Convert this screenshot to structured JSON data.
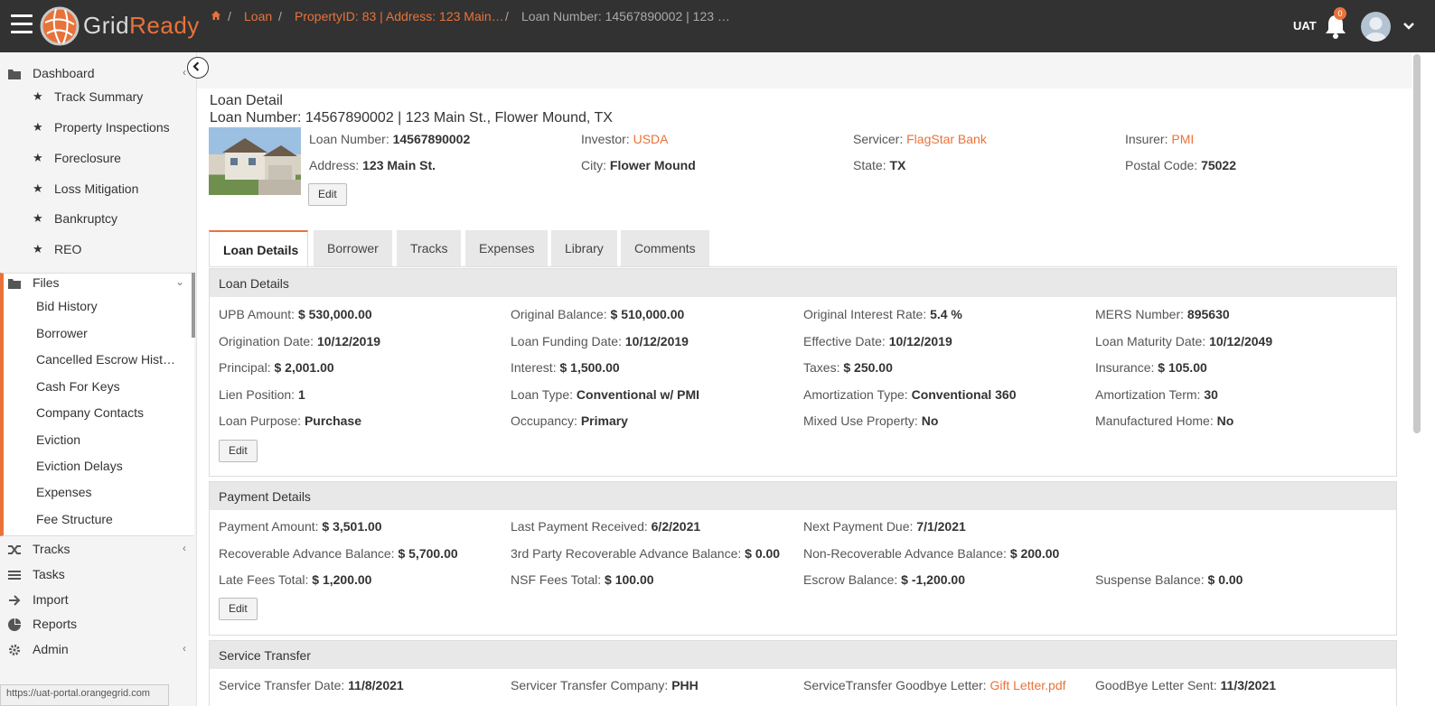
{
  "header": {
    "logo_grid": "Grid",
    "logo_ready": "Ready",
    "env": "UAT",
    "notif_count": "0",
    "accent": "#e8733a",
    "bar_color": "#323232"
  },
  "sidebar": {
    "dashboard": "Dashboard",
    "dashboard_items": [
      "Track Summary",
      "Property Inspections",
      "Foreclosure",
      "Loss Mitigation",
      "Bankruptcy",
      "REO"
    ],
    "files": "Files",
    "files_items": [
      "Bid History",
      "Borrower",
      "Cancelled Escrow Hist…",
      "Cash For Keys",
      "Company Contacts",
      "Eviction",
      "Eviction Delays",
      "Expenses",
      "Fee Structure"
    ],
    "tracks": "Tracks",
    "tasks": "Tasks",
    "import": "Import",
    "reports": "Reports",
    "admin": "Admin"
  },
  "status_url": "https://uat-portal.orangegrid.com",
  "breadcrumb": {
    "loan": "Loan",
    "property": "PropertyID: 83 | Address: 123 Main…",
    "current": "Loan Number: 14567890002 | 123 …"
  },
  "page": {
    "title": "Loan Detail",
    "subtitle": "Loan Number: 14567890002 | 123 Main St., Flower Mound, TX"
  },
  "summary": {
    "loan_number_label": "Loan Number:",
    "loan_number": "14567890002",
    "investor_label": "Investor:",
    "investor": "USDA",
    "servicer_label": "Servicer:",
    "servicer": "FlagStar Bank",
    "insurer_label": "Insurer:",
    "insurer": "PMI",
    "address_label": "Address:",
    "address": "123 Main St.",
    "city_label": "City:",
    "city": "Flower Mound",
    "state_label": "State:",
    "state": "TX",
    "postal_label": "Postal Code:",
    "postal": "75022",
    "edit": "Edit"
  },
  "tabs": [
    "Loan Details",
    "Borrower",
    "Tracks",
    "Expenses",
    "Library",
    "Comments"
  ],
  "loan_details": {
    "title": "Loan Details",
    "edit": "Edit",
    "rows": [
      [
        [
          "UPB Amount:",
          "$ 530,000.00"
        ],
        [
          "Original Balance:",
          "$ 510,000.00"
        ],
        [
          "Original Interest Rate:",
          "5.4 %"
        ],
        [
          "MERS Number:",
          "895630"
        ]
      ],
      [
        [
          "Origination Date:",
          "10/12/2019"
        ],
        [
          "Loan Funding Date:",
          "10/12/2019"
        ],
        [
          "Effective Date:",
          "10/12/2019"
        ],
        [
          "Loan Maturity Date:",
          "10/12/2049"
        ]
      ],
      [
        [
          "Principal:",
          "$ 2,001.00"
        ],
        [
          "Interest:",
          "$ 1,500.00"
        ],
        [
          "Taxes:",
          "$ 250.00"
        ],
        [
          "Insurance:",
          "$ 105.00"
        ]
      ],
      [
        [
          "Lien Position:",
          "1"
        ],
        [
          "Loan Type:",
          "Conventional w/ PMI"
        ],
        [
          "Amortization Type:",
          "Conventional 360"
        ],
        [
          "Amortization Term:",
          "30"
        ]
      ],
      [
        [
          "Loan Purpose:",
          "Purchase"
        ],
        [
          "Occupancy:",
          "Primary"
        ],
        [
          "Mixed Use Property:",
          "No"
        ],
        [
          "Manufactured Home:",
          "No"
        ]
      ]
    ]
  },
  "payment_details": {
    "title": "Payment Details",
    "edit": "Edit",
    "rows": [
      [
        [
          "Payment Amount:",
          "$ 3,501.00"
        ],
        [
          "Last Payment Received:",
          "6/2/2021"
        ],
        [
          "Next Payment Due:",
          "7/1/2021"
        ]
      ],
      [
        [
          "Recoverable Advance Balance:",
          "$ 5,700.00"
        ],
        [
          "3rd Party Recoverable Advance Balance:",
          "$ 0.00"
        ],
        [
          "Non-Recoverable Advance Balance:",
          "$ 200.00"
        ]
      ],
      [
        [
          "Late Fees Total:",
          "$ 1,200.00"
        ],
        [
          "NSF Fees Total:",
          "$ 100.00"
        ],
        [
          "Escrow Balance:",
          "$ -1,200.00"
        ],
        [
          "Suspense Balance:",
          "$ 0.00"
        ]
      ]
    ]
  },
  "service_transfer": {
    "title": "Service Transfer",
    "date_label": "Service Transfer Date:",
    "date": "11/8/2021",
    "company_label": "Servicer Transfer Company:",
    "company": "PHH",
    "letter_label": "ServiceTransfer Goodbye Letter:",
    "letter": "Gift Letter.pdf",
    "sent_label": "GoodBye Letter Sent:",
    "sent": "11/3/2021"
  }
}
